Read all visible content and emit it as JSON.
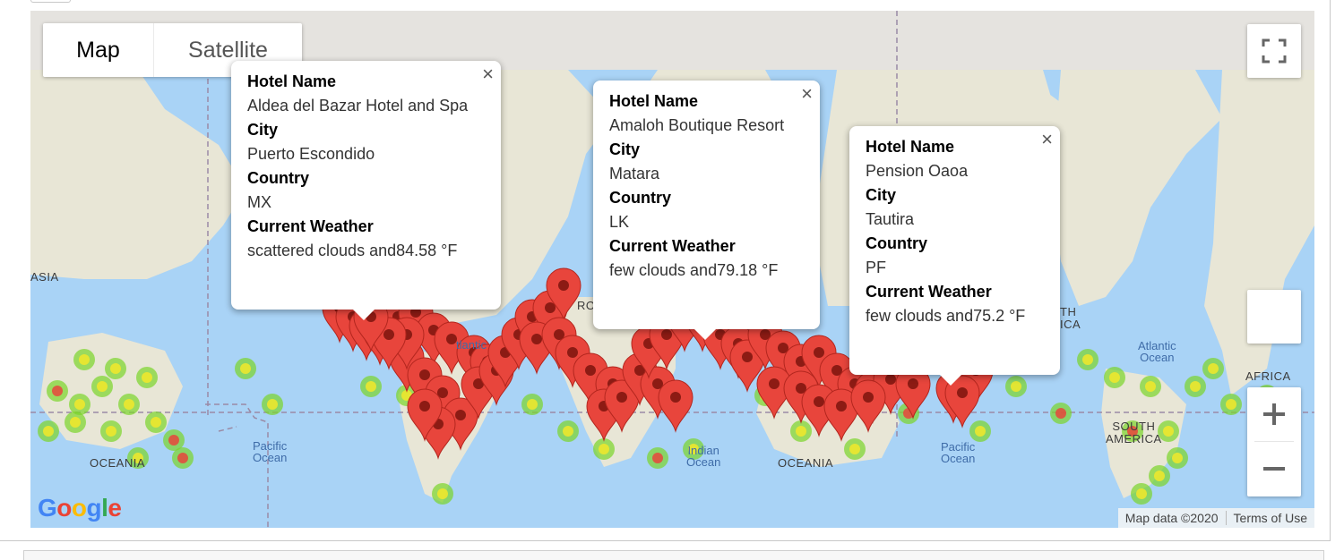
{
  "map_type": {
    "map_label": "Map",
    "satellite_label": "Satellite",
    "selected": "Map"
  },
  "info_windows": [
    {
      "hotel_label": "Hotel Name",
      "hotel": "Aldea del Bazar Hotel and Spa",
      "city_label": "City",
      "city": "Puerto Escondido",
      "country_label": "Country",
      "country": "MX",
      "weather_label": "Current Weather",
      "weather": "scattered clouds and84.58 °F"
    },
    {
      "hotel_label": "Hotel Name",
      "hotel": "Amaloh Boutique Resort",
      "city_label": "City",
      "city": "Matara",
      "country_label": "Country",
      "country": "LK",
      "weather_label": "Current Weather",
      "weather": "few clouds and79.18 °F"
    },
    {
      "hotel_label": "Hotel Name",
      "hotel": "Pension Oaoa",
      "city_label": "City",
      "city": "Tautira",
      "country_label": "Country",
      "country": "PF",
      "weather_label": "Current Weather",
      "weather": "few clouds and75.2 °F"
    }
  ],
  "close_glyph": "×",
  "map_labels": {
    "asia": "ASIA",
    "oceania_left": "OCEANIA",
    "oceania_mid": "OCEANIA",
    "africa": "AFRICA",
    "south_america": "SOUTH\nAMERICA",
    "pacific_left": "Pacific\nOcean",
    "pacific_right": "Pacific\nOcean",
    "indian": "Indian\nOcean",
    "atlantic": "Atlantic\nOcean",
    "atlantic_partial": "tlantic",
    "north_partial": "RO",
    "th_partial": "TH",
    "ica_partial": "ICA"
  },
  "logo": {
    "letters": [
      "G",
      "o",
      "o",
      "g",
      "l",
      "e"
    ],
    "colors": [
      "#4285F4",
      "#EA4335",
      "#FBBC05",
      "#4285F4",
      "#34A853",
      "#EA4335"
    ]
  },
  "attribution": {
    "map_data": "Map data ©2020",
    "terms": "Terms of Use"
  },
  "zoom": {
    "in": "+",
    "out": "−"
  },
  "colors": {
    "water": "#a9d3f6",
    "land": "#e8e6d6",
    "marker": "#e8453c",
    "marker_dot": "#8c1b14",
    "heat_green": "#7bd42a",
    "heat_yellow": "#f2e72a",
    "heat_red": "#e8453c"
  }
}
